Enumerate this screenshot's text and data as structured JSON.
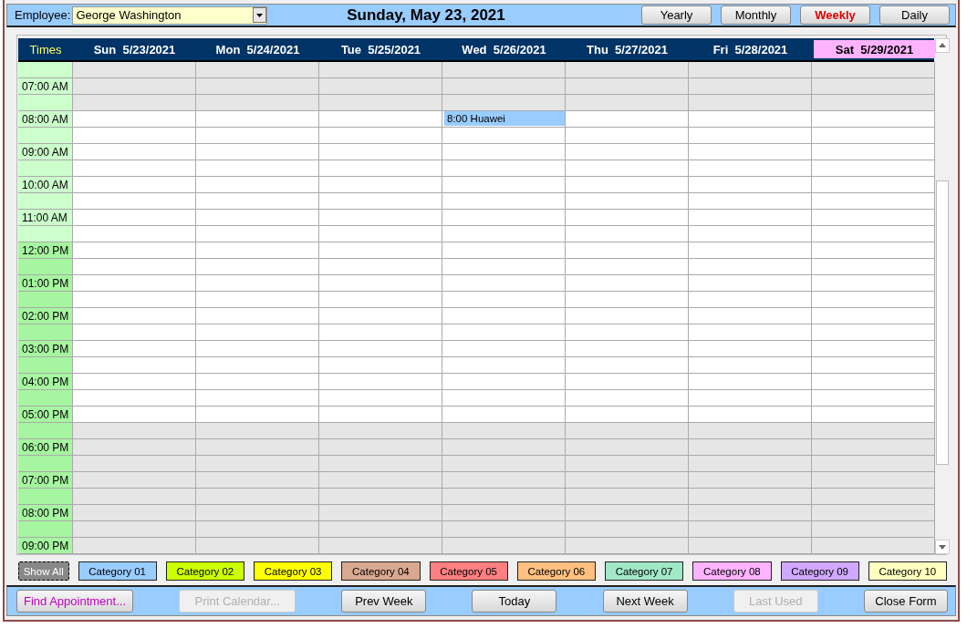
{
  "header": {
    "employee_label": "Employee:",
    "employee": "George Washington",
    "title": "Sunday, May 23, 2021",
    "views": [
      {
        "label": "Yearly",
        "selected": false
      },
      {
        "label": "Monthly",
        "selected": false
      },
      {
        "label": "Weekly",
        "selected": true
      },
      {
        "label": "Daily",
        "selected": false
      }
    ]
  },
  "calendar": {
    "times_heading": "Times",
    "days": [
      {
        "label": "Sun  5/23/2021",
        "selected": false
      },
      {
        "label": "Mon  5/24/2021",
        "selected": false
      },
      {
        "label": "Tue  5/25/2021",
        "selected": false
      },
      {
        "label": "Wed  5/26/2021",
        "selected": false
      },
      {
        "label": "Thu  5/27/2021",
        "selected": false
      },
      {
        "label": "Fri  5/28/2021",
        "selected": false
      },
      {
        "label": "Sat  5/29/2021",
        "selected": true
      }
    ],
    "rows": [
      {
        "work_hours": false,
        "pm": false,
        "cells": []
      },
      {
        "time": "07:00 AM",
        "work_hours": false,
        "pm": false,
        "cells": []
      },
      {
        "work_hours": false,
        "pm": false,
        "cells": []
      },
      {
        "time": "08:00 AM",
        "work_hours": true,
        "pm": false,
        "cells": [
          {},
          {},
          {},
          {
            "appointment": "8:00 Huawei"
          },
          {},
          {},
          {}
        ]
      },
      {
        "work_hours": true,
        "pm": false,
        "cells": []
      },
      {
        "time": "09:00 AM",
        "work_hours": true,
        "pm": false,
        "cells": []
      },
      {
        "work_hours": true,
        "pm": false,
        "cells": []
      },
      {
        "time": "10:00 AM",
        "work_hours": true,
        "pm": false,
        "cells": []
      },
      {
        "work_hours": true,
        "pm": false,
        "cells": []
      },
      {
        "time": "11:00 AM",
        "work_hours": true,
        "pm": false,
        "cells": []
      },
      {
        "work_hours": true,
        "pm": false,
        "cells": []
      },
      {
        "time": "12:00 PM",
        "work_hours": true,
        "pm": true,
        "cells": []
      },
      {
        "work_hours": true,
        "pm": true,
        "cells": []
      },
      {
        "time": "01:00 PM",
        "work_hours": true,
        "pm": true,
        "cells": []
      },
      {
        "work_hours": true,
        "pm": true,
        "cells": []
      },
      {
        "time": "02:00 PM",
        "work_hours": true,
        "pm": true,
        "cells": []
      },
      {
        "work_hours": true,
        "pm": true,
        "cells": []
      },
      {
        "time": "03:00 PM",
        "work_hours": true,
        "pm": true,
        "cells": []
      },
      {
        "work_hours": true,
        "pm": true,
        "cells": []
      },
      {
        "time": "04:00 PM",
        "work_hours": true,
        "pm": true,
        "cells": []
      },
      {
        "work_hours": true,
        "pm": true,
        "cells": []
      },
      {
        "time": "05:00 PM",
        "work_hours": true,
        "pm": true,
        "cells": []
      },
      {
        "work_hours": false,
        "pm": true,
        "cells": []
      },
      {
        "time": "06:00 PM",
        "work_hours": false,
        "pm": true,
        "cells": []
      },
      {
        "work_hours": false,
        "pm": true,
        "cells": []
      },
      {
        "time": "07:00 PM",
        "work_hours": false,
        "pm": true,
        "cells": []
      },
      {
        "work_hours": false,
        "pm": true,
        "cells": []
      },
      {
        "time": "08:00 PM",
        "work_hours": false,
        "pm": true,
        "cells": []
      },
      {
        "work_hours": false,
        "pm": true,
        "cells": []
      },
      {
        "time": "09:00 PM",
        "work_hours": false,
        "pm": true,
        "cells": []
      }
    ]
  },
  "categories": [
    {
      "label": "Show All",
      "kind": "all"
    },
    {
      "label": "Category 01",
      "kind": "category",
      "color": "#99ccff"
    },
    {
      "label": "Category 02",
      "kind": "category",
      "color": "#ccff00"
    },
    {
      "label": "Category 03",
      "kind": "category",
      "color": "#ffff00"
    },
    {
      "label": "Category 04",
      "kind": "category",
      "color": "#d9a890"
    },
    {
      "label": "Category 05",
      "kind": "category",
      "color": "#ff8080"
    },
    {
      "label": "Category 06",
      "kind": "category",
      "color": "#ffc080"
    },
    {
      "label": "Category 07",
      "kind": "category",
      "color": "#a0e8c8"
    },
    {
      "label": "Category 08",
      "kind": "category",
      "color": "#ffb3ff"
    },
    {
      "label": "Category 09",
      "kind": "category",
      "color": "#d0a8ff"
    },
    {
      "label": "Category 10",
      "kind": "category",
      "color": "#ffffc0"
    }
  ],
  "footer_buttons": [
    {
      "label": "Find Appointment...",
      "kind": "link",
      "disabled": false
    },
    {
      "label": "Print Calendar...",
      "kind": "normal",
      "disabled": true
    },
    {
      "label": "Prev Week",
      "kind": "normal",
      "disabled": false
    },
    {
      "label": "Today",
      "kind": "normal",
      "disabled": false
    },
    {
      "label": "Next Week",
      "kind": "normal",
      "disabled": false
    },
    {
      "label": "Last Used",
      "kind": "normal",
      "disabled": true
    },
    {
      "label": "Close Form",
      "kind": "normal",
      "disabled": false
    }
  ]
}
